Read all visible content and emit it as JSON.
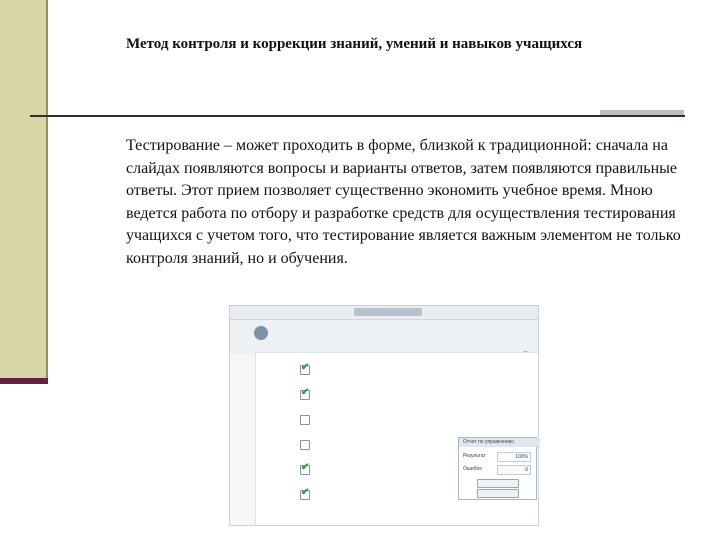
{
  "slide": {
    "title": "Метод контроля и коррекции знаний, умений и навыков учащихся",
    "body": "Тестирование – может проходить в форме, близкой к традиционной: сначала на слайдах появляются вопросы и варианты ответов, затем появляются правильные ответы. Этот прием позволяет существенно экономить учебное время. Мною ведется работа по отбору и разработке средств для осуществления тестирования учащихся с учетом того, что тестирование является важным элементом не только контроля знаний, но и обучения."
  },
  "colors": {
    "side_band": "#d6d6a6",
    "side_band_edge": "#6b1f3f",
    "rule": "#3b2b2b",
    "check": "#2a9a3a"
  },
  "test_window": {
    "options": [
      {
        "checked": true
      },
      {
        "checked": true
      },
      {
        "checked": false
      },
      {
        "checked": false
      },
      {
        "checked": true
      },
      {
        "checked": true
      }
    ],
    "result": {
      "head": "Отчет по упражнению",
      "score_label": "Результат",
      "score_value": "100%",
      "errors_label": "Ошибок",
      "errors_value": "0"
    },
    "icons": [
      "question-icon",
      "nav-icon"
    ]
  }
}
